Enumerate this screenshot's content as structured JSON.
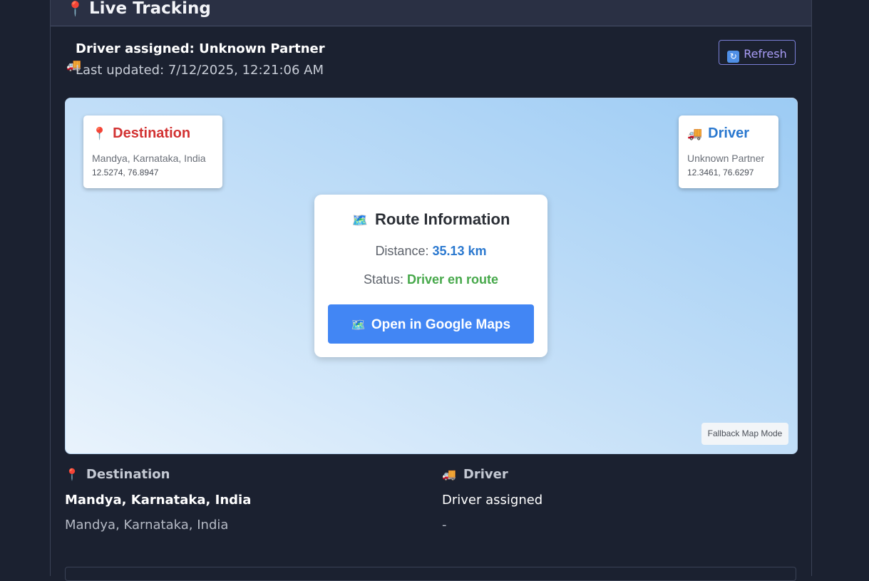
{
  "header": {
    "title": "Live Tracking",
    "title_icon": "📍"
  },
  "status": {
    "assigned_text": "Driver assigned: Unknown Partner",
    "truck_icon": "🚚",
    "updated_text": "Last updated: 7/12/2025, 12:21:06 AM",
    "refresh_icon": "🔄",
    "refresh_label": "Refresh"
  },
  "map": {
    "destination": {
      "icon": "📍",
      "label": "Destination",
      "name": "Mandya, Karnataka, India",
      "coords": "12.5274, 76.8947"
    },
    "driver": {
      "icon": "🚚",
      "label": "Driver",
      "name": "Unknown Partner",
      "coords": "12.3461, 76.6297"
    },
    "route": {
      "icon": "🗺️",
      "title": "Route Information",
      "distance_label": "Distance:",
      "distance_value": "35.13 km",
      "status_label": "Status:",
      "status_value": "Driver en route",
      "button_icon": "🗺️",
      "button_label": "Open in Google Maps"
    },
    "mode_label": "Fallback Map Mode"
  },
  "details": {
    "destination": {
      "icon": "📍",
      "heading": "Destination",
      "main": "Mandya, Karnataka, India",
      "sub": "Mandya, Karnataka, India"
    },
    "driver": {
      "icon": "🚚",
      "heading": "Driver",
      "main": "Driver assigned",
      "sub": "-"
    }
  },
  "colors": {
    "page_bg": "#1b2130",
    "header_bg": "#2a3044",
    "accent_blue": "#2a78cf",
    "button_blue": "#4286f4",
    "status_green": "#46a84a",
    "destination_red": "#d23232",
    "refresh_purple": "#a89cf6"
  }
}
